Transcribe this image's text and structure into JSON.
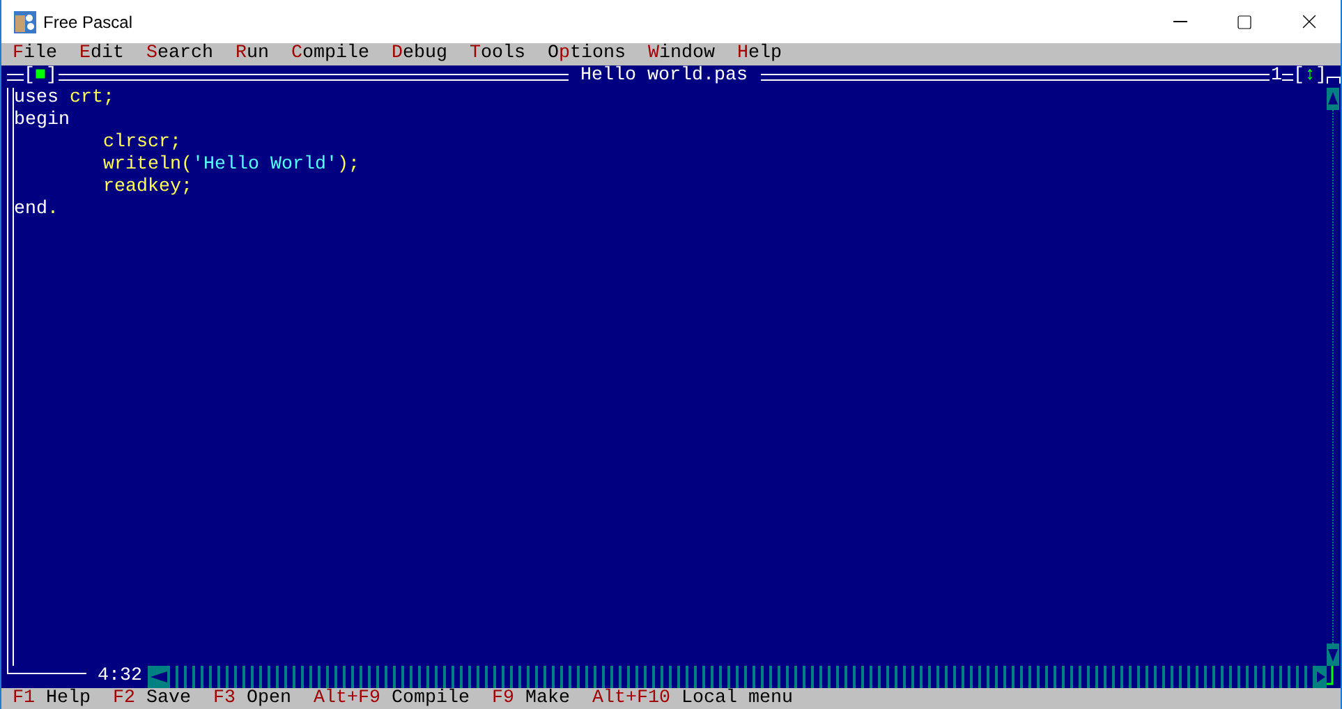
{
  "window": {
    "title": "Free Pascal"
  },
  "menu": [
    {
      "key": "F",
      "after": "ile"
    },
    {
      "key": "E",
      "after": "dit"
    },
    {
      "key": "S",
      "after": "earch"
    },
    {
      "key": "R",
      "after": "un"
    },
    {
      "key": "C",
      "after": "ompile"
    },
    {
      "key": "D",
      "after": "ebug"
    },
    {
      "key": "T",
      "after": "ools"
    },
    {
      "before": "O",
      "key": "p",
      "after": "tions"
    },
    {
      "key": "W",
      "after": "indow"
    },
    {
      "key": "H",
      "after": "elp"
    }
  ],
  "editor": {
    "title": "Hello world.pas",
    "close_button": {
      "left": "[",
      "mark": "■",
      "right": "]"
    },
    "window_number": "1",
    "zoom_button": {
      "left": "[",
      "mark": "↕",
      "right": "]"
    },
    "cursor_position": "4:32",
    "lines": [
      [
        {
          "kind": "keyword",
          "text": "uses "
        },
        {
          "kind": "ident",
          "text": "crt;"
        }
      ],
      [
        {
          "kind": "keyword",
          "text": "begin"
        }
      ],
      [
        {
          "kind": "ident",
          "text": "        clrscr;"
        }
      ],
      [
        {
          "kind": "ident",
          "text": "        writeln("
        },
        {
          "kind": "string",
          "text": "'Hello World'"
        },
        {
          "kind": "ident",
          "text": ");"
        }
      ],
      [
        {
          "kind": "ident",
          "text": "        readkey;"
        }
      ],
      [
        {
          "kind": "keyword",
          "text": "end"
        },
        {
          "kind": "ident",
          "text": "."
        }
      ]
    ]
  },
  "status_bar": [
    {
      "key": "F1",
      "label": "Help"
    },
    {
      "key": "F2",
      "label": "Save"
    },
    {
      "key": "F3",
      "label": "Open"
    },
    {
      "key": "Alt+F9",
      "label": "Compile"
    },
    {
      "key": "F9",
      "label": "Make"
    },
    {
      "key": "Alt+F10",
      "label": "Local menu"
    }
  ]
}
